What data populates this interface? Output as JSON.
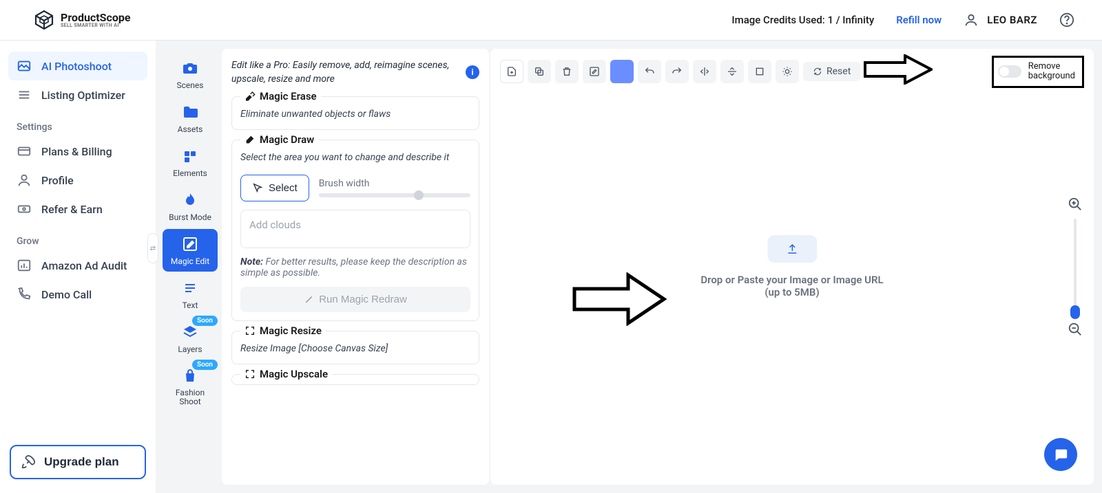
{
  "header": {
    "logo_title": "ProductScope",
    "logo_sub": "SELL SMARTER WITH AI",
    "credits": "Image Credits Used: 1 / Infinity",
    "refill": "Refill now",
    "user_name": "LEO BARZ"
  },
  "sidebar": {
    "items": [
      {
        "label": "AI Photoshoot",
        "active": true
      },
      {
        "label": "Listing Optimizer"
      }
    ],
    "settings_label": "Settings",
    "settings_items": [
      {
        "label": "Plans & Billing"
      },
      {
        "label": "Profile"
      },
      {
        "label": "Refer & Earn"
      }
    ],
    "grow_label": "Grow",
    "grow_items": [
      {
        "label": "Amazon Ad Audit"
      },
      {
        "label": "Demo Call"
      }
    ],
    "upgrade": "Upgrade plan"
  },
  "tool_rail": {
    "items": [
      {
        "label": "Scenes"
      },
      {
        "label": "Assets"
      },
      {
        "label": "Elements"
      },
      {
        "label": "Burst Mode"
      },
      {
        "label": "Magic Edit",
        "active": true
      },
      {
        "label": "Text"
      },
      {
        "label": "Layers",
        "soon": true
      },
      {
        "label": "Fashion Shoot",
        "soon": true
      }
    ],
    "soon_badge": "Soon"
  },
  "panel": {
    "intro": "Edit like a Pro: Easily remove, add, reimagine scenes, upscale, resize and more",
    "erase": {
      "title": "Magic Erase",
      "desc": "Eliminate unwanted objects or flaws"
    },
    "draw": {
      "title": "Magic Draw",
      "desc": "Select the area you want to change and describe it",
      "select": "Select",
      "brush_label": "Brush width",
      "placeholder": "Add clouds",
      "note_label": "Note:",
      "note_text": " For better results, please keep the description as simple as possible.",
      "run": "Run Magic Redraw"
    },
    "resize": {
      "title": "Magic Resize",
      "desc": "Resize Image [Choose Canvas Size]"
    },
    "upscale": {
      "title": "Magic Upscale"
    }
  },
  "toolbar": {
    "reset": "Reset",
    "remove_bg_line1": "Remove",
    "remove_bg_line2": "background"
  },
  "canvas": {
    "drop_line1": "Drop or Paste your Image or Image URL",
    "drop_line2": "(up to 5MB)"
  }
}
